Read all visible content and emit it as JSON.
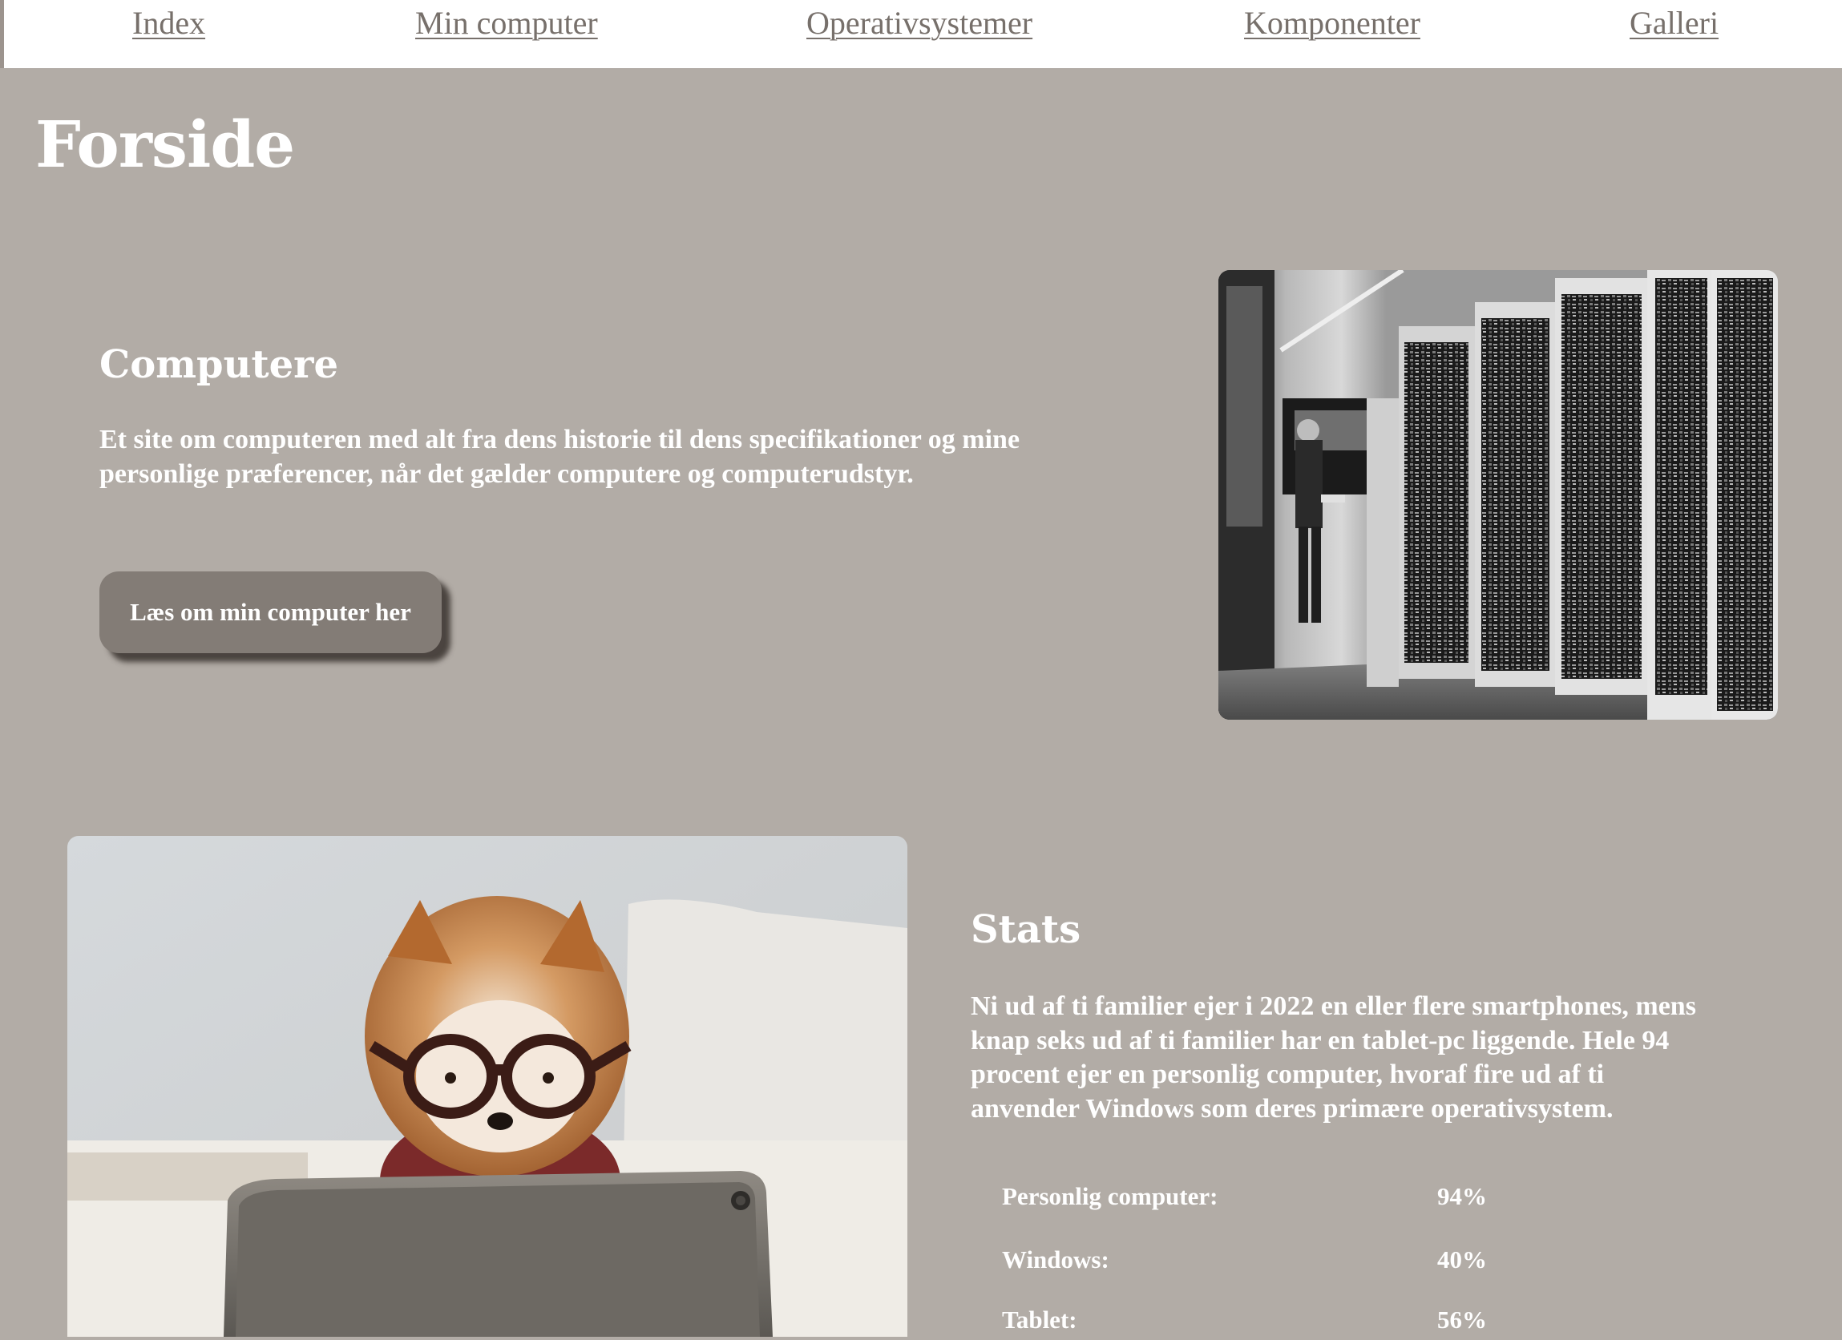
{
  "nav": {
    "items": [
      "Index",
      "Min computer",
      "Operativsystemer",
      "Komponenter",
      "Galleri"
    ]
  },
  "page": {
    "title": "Forside"
  },
  "intro": {
    "heading": "Computere",
    "text_line1": "Et site om computeren med alt fra dens historie til dens specifikationer og mine",
    "text_line2": "personlige præferencer, når det gælder computere og computerudstyr.",
    "button_label": "Læs om min computer her",
    "image_icon": "vintage-mainframe-photo"
  },
  "stats": {
    "heading": "Stats",
    "text_lines": [
      "Ni ud af ti familier ejer i 2022 en eller flere smartphones, mens",
      "knap seks ud af ti familier har en tablet-pc liggende. Hele 94",
      "procent ejer en personlig computer, hvoraf fire ud af ti",
      "anvender Windows som deres primære operativsystem."
    ],
    "rows": [
      {
        "label": "Personlig computer:",
        "value": "94%"
      },
      {
        "label": "Windows:",
        "value": "40%"
      },
      {
        "label": "Tablet:",
        "value": "56%"
      }
    ],
    "image_icon": "dog-with-glasses-photo"
  },
  "colors": {
    "background": "#b2aca6",
    "nav_background": "#ffffff",
    "nav_link": "#77706b",
    "button": "#837c76",
    "text": "#ffffff"
  }
}
